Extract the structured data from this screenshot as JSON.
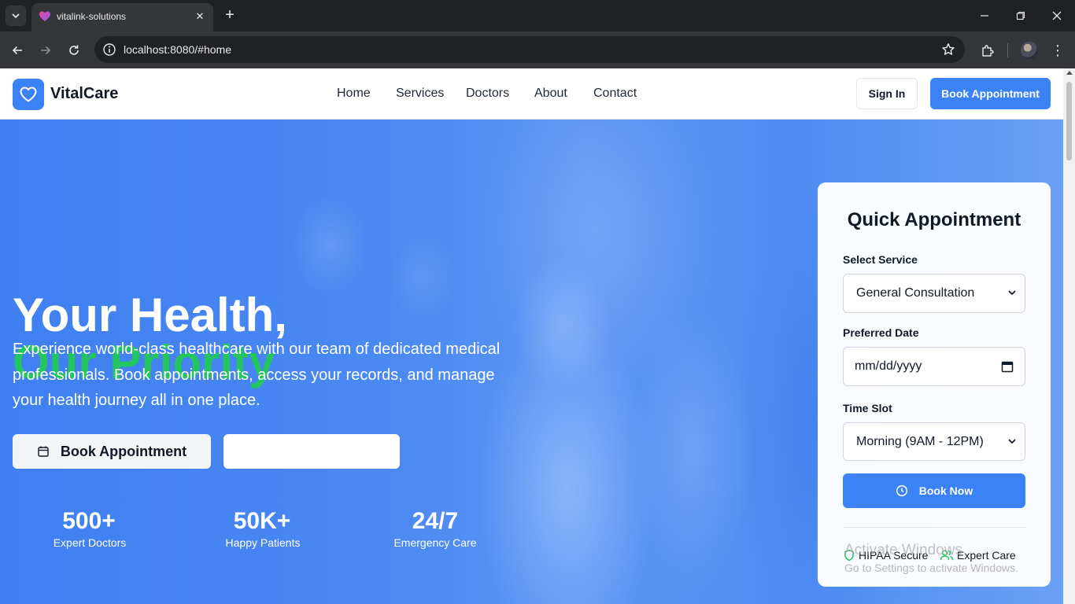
{
  "browser": {
    "tab_title": "vitalink-solutions",
    "url": "localhost:8080/#home"
  },
  "header": {
    "brand": "VitalCare",
    "nav": [
      "Home",
      "Services",
      "Doctors",
      "About",
      "Contact"
    ],
    "sign_in": "Sign In",
    "book_appointment": "Book Appointment"
  },
  "hero": {
    "title_line1": "Your Health,",
    "title_line2": "Our Priority",
    "description": "Experience world-class healthcare with our team of dedicated medical professionals. Book appointments, access your records, and manage your health journey all in one place.",
    "primary_button": "Book Appointment",
    "stats": [
      {
        "value": "500+",
        "label": "Expert Doctors"
      },
      {
        "value": "50K+",
        "label": "Happy Patients"
      },
      {
        "value": "24/7",
        "label": "Emergency Care"
      }
    ]
  },
  "appointment": {
    "title": "Quick Appointment",
    "service_label": "Select Service",
    "service_value": "General Consultation",
    "date_label": "Preferred Date",
    "date_placeholder": "mm/dd/yyyy",
    "time_label": "Time Slot",
    "time_value": "Morning (9AM - 12PM)",
    "submit": "Book Now",
    "badges": [
      "HIPAA Secure",
      "Expert Care"
    ]
  },
  "watermark": {
    "line1": "Activate Windows",
    "line2": "Go to Settings to activate Windows."
  },
  "colors": {
    "primary": "#3b82f6",
    "accent_green": "#22c55e"
  }
}
